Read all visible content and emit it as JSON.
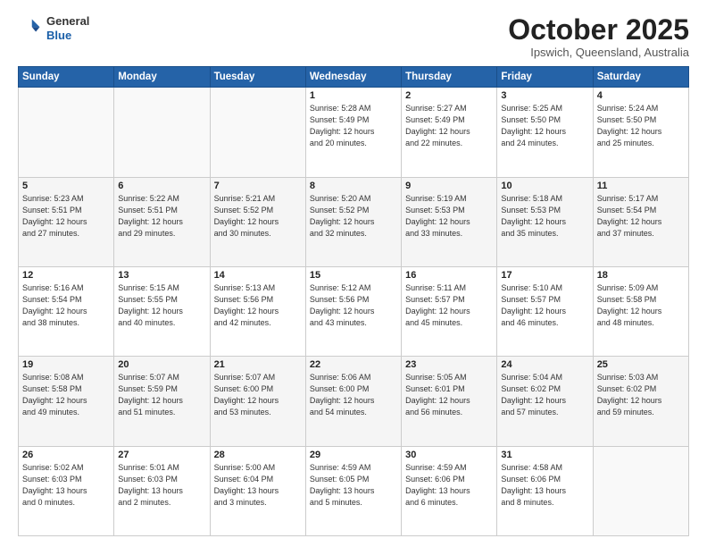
{
  "header": {
    "logo": {
      "line1": "General",
      "line2": "Blue"
    },
    "title": "October 2025",
    "subtitle": "Ipswich, Queensland, Australia"
  },
  "days_of_week": [
    "Sunday",
    "Monday",
    "Tuesday",
    "Wednesday",
    "Thursday",
    "Friday",
    "Saturday"
  ],
  "weeks": [
    [
      {
        "day": "",
        "info": ""
      },
      {
        "day": "",
        "info": ""
      },
      {
        "day": "",
        "info": ""
      },
      {
        "day": "1",
        "info": "Sunrise: 5:28 AM\nSunset: 5:49 PM\nDaylight: 12 hours\nand 20 minutes."
      },
      {
        "day": "2",
        "info": "Sunrise: 5:27 AM\nSunset: 5:49 PM\nDaylight: 12 hours\nand 22 minutes."
      },
      {
        "day": "3",
        "info": "Sunrise: 5:25 AM\nSunset: 5:50 PM\nDaylight: 12 hours\nand 24 minutes."
      },
      {
        "day": "4",
        "info": "Sunrise: 5:24 AM\nSunset: 5:50 PM\nDaylight: 12 hours\nand 25 minutes."
      }
    ],
    [
      {
        "day": "5",
        "info": "Sunrise: 5:23 AM\nSunset: 5:51 PM\nDaylight: 12 hours\nand 27 minutes."
      },
      {
        "day": "6",
        "info": "Sunrise: 5:22 AM\nSunset: 5:51 PM\nDaylight: 12 hours\nand 29 minutes."
      },
      {
        "day": "7",
        "info": "Sunrise: 5:21 AM\nSunset: 5:52 PM\nDaylight: 12 hours\nand 30 minutes."
      },
      {
        "day": "8",
        "info": "Sunrise: 5:20 AM\nSunset: 5:52 PM\nDaylight: 12 hours\nand 32 minutes."
      },
      {
        "day": "9",
        "info": "Sunrise: 5:19 AM\nSunset: 5:53 PM\nDaylight: 12 hours\nand 33 minutes."
      },
      {
        "day": "10",
        "info": "Sunrise: 5:18 AM\nSunset: 5:53 PM\nDaylight: 12 hours\nand 35 minutes."
      },
      {
        "day": "11",
        "info": "Sunrise: 5:17 AM\nSunset: 5:54 PM\nDaylight: 12 hours\nand 37 minutes."
      }
    ],
    [
      {
        "day": "12",
        "info": "Sunrise: 5:16 AM\nSunset: 5:54 PM\nDaylight: 12 hours\nand 38 minutes."
      },
      {
        "day": "13",
        "info": "Sunrise: 5:15 AM\nSunset: 5:55 PM\nDaylight: 12 hours\nand 40 minutes."
      },
      {
        "day": "14",
        "info": "Sunrise: 5:13 AM\nSunset: 5:56 PM\nDaylight: 12 hours\nand 42 minutes."
      },
      {
        "day": "15",
        "info": "Sunrise: 5:12 AM\nSunset: 5:56 PM\nDaylight: 12 hours\nand 43 minutes."
      },
      {
        "day": "16",
        "info": "Sunrise: 5:11 AM\nSunset: 5:57 PM\nDaylight: 12 hours\nand 45 minutes."
      },
      {
        "day": "17",
        "info": "Sunrise: 5:10 AM\nSunset: 5:57 PM\nDaylight: 12 hours\nand 46 minutes."
      },
      {
        "day": "18",
        "info": "Sunrise: 5:09 AM\nSunset: 5:58 PM\nDaylight: 12 hours\nand 48 minutes."
      }
    ],
    [
      {
        "day": "19",
        "info": "Sunrise: 5:08 AM\nSunset: 5:58 PM\nDaylight: 12 hours\nand 49 minutes."
      },
      {
        "day": "20",
        "info": "Sunrise: 5:07 AM\nSunset: 5:59 PM\nDaylight: 12 hours\nand 51 minutes."
      },
      {
        "day": "21",
        "info": "Sunrise: 5:07 AM\nSunset: 6:00 PM\nDaylight: 12 hours\nand 53 minutes."
      },
      {
        "day": "22",
        "info": "Sunrise: 5:06 AM\nSunset: 6:00 PM\nDaylight: 12 hours\nand 54 minutes."
      },
      {
        "day": "23",
        "info": "Sunrise: 5:05 AM\nSunset: 6:01 PM\nDaylight: 12 hours\nand 56 minutes."
      },
      {
        "day": "24",
        "info": "Sunrise: 5:04 AM\nSunset: 6:02 PM\nDaylight: 12 hours\nand 57 minutes."
      },
      {
        "day": "25",
        "info": "Sunrise: 5:03 AM\nSunset: 6:02 PM\nDaylight: 12 hours\nand 59 minutes."
      }
    ],
    [
      {
        "day": "26",
        "info": "Sunrise: 5:02 AM\nSunset: 6:03 PM\nDaylight: 13 hours\nand 0 minutes."
      },
      {
        "day": "27",
        "info": "Sunrise: 5:01 AM\nSunset: 6:03 PM\nDaylight: 13 hours\nand 2 minutes."
      },
      {
        "day": "28",
        "info": "Sunrise: 5:00 AM\nSunset: 6:04 PM\nDaylight: 13 hours\nand 3 minutes."
      },
      {
        "day": "29",
        "info": "Sunrise: 4:59 AM\nSunset: 6:05 PM\nDaylight: 13 hours\nand 5 minutes."
      },
      {
        "day": "30",
        "info": "Sunrise: 4:59 AM\nSunset: 6:06 PM\nDaylight: 13 hours\nand 6 minutes."
      },
      {
        "day": "31",
        "info": "Sunrise: 4:58 AM\nSunset: 6:06 PM\nDaylight: 13 hours\nand 8 minutes."
      },
      {
        "day": "",
        "info": ""
      }
    ]
  ]
}
